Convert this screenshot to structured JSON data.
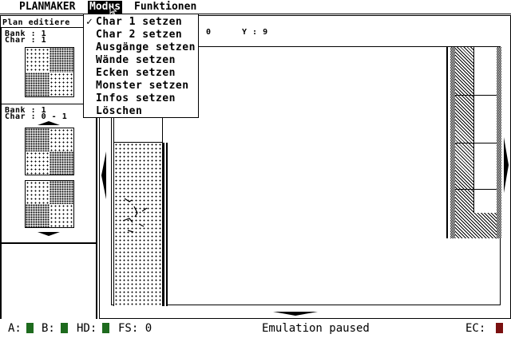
{
  "menubar": {
    "items": [
      "PLANMAKER",
      "Modus",
      "Funktionen"
    ],
    "active": "Modus"
  },
  "modus_menu": {
    "items": [
      {
        "check": "✓",
        "label": "Char 1 setzen"
      },
      {
        "check": "",
        "label": "Char 2 setzen"
      },
      {
        "check": "",
        "label": "Ausgänge setzen"
      },
      {
        "check": "",
        "label": "Wände setzen"
      },
      {
        "check": "",
        "label": "Ecken setzen"
      },
      {
        "check": "",
        "label": "Monster setzen"
      },
      {
        "check": "",
        "label": "Infos setzen"
      },
      {
        "check": "",
        "label": "Löschen"
      }
    ]
  },
  "left_panel": {
    "title": "Plan editiere",
    "top": {
      "bank_label": "Bank : 1",
      "char_label": "Char : 1"
    },
    "middle": {
      "bank_label": "Bank : 1",
      "char_label": "Char : 0 - 1"
    }
  },
  "editor": {
    "coord_x": "0",
    "coord_y_label": "Y : 9"
  },
  "status_bar": {
    "drive_a": "A:",
    "drive_b": "B:",
    "hd": "HD:",
    "fs": "FS: 0",
    "message": "Emulation paused",
    "ec": "EC:"
  },
  "colors": {
    "led_green": "#1e6b1e",
    "led_red": "#7a1010"
  },
  "icons": {
    "cursor": "mouse-pointer-icon",
    "scroll_up": "triangle-up-icon",
    "scroll_down": "triangle-down-icon",
    "scroll_left": "triangle-left-icon",
    "scroll_right": "triangle-right-icon"
  }
}
